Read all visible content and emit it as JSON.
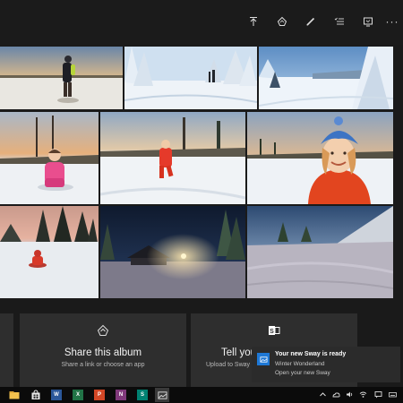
{
  "toolbar": {
    "buttons": [
      "share-upload",
      "enhance",
      "edit",
      "select",
      "present",
      "more"
    ],
    "more_label": "···"
  },
  "photos": [
    {
      "name": "photo-snow-child-standing",
      "scene": "snow field at dusk with child in black coat"
    },
    {
      "name": "photo-snowy-trees-people",
      "scene": "snowy forest with two people"
    },
    {
      "name": "photo-snow-covered-pines",
      "scene": "snow covered pines under blue sky"
    },
    {
      "name": "photo-girl-sitting-snow",
      "scene": "girl in pink jacket sitting in snow"
    },
    {
      "name": "photo-child-walking-snow",
      "scene": "child in red suit walking on snow"
    },
    {
      "name": "photo-girl-blue-hat",
      "scene": "smiling girl in blue hat and red coat"
    },
    {
      "name": "photo-child-sled-dusk",
      "scene": "child on sled at dusk"
    },
    {
      "name": "photo-cabin-night",
      "scene": "cabin at night with lamp"
    },
    {
      "name": "photo-snow-slope-twilight",
      "scene": "snowy slope at twilight"
    }
  ],
  "cards": {
    "share": {
      "title": "Share this album",
      "subtitle": "Share a link or choose an app"
    },
    "sway": {
      "title": "Tell your",
      "subtitle": "Upload to Sway"
    }
  },
  "toast": {
    "title": "Your new Sway is ready",
    "line1": "Winter Wonderland",
    "line2": "Open your new Sway"
  },
  "taskbar": {
    "apps": [
      {
        "name": "file-explorer-icon",
        "color": "#f2c14e",
        "letter": ""
      },
      {
        "name": "store-icon",
        "color": "#e8e8e8",
        "letter": ""
      },
      {
        "name": "word-icon",
        "color": "#2b579a",
        "letter": "W"
      },
      {
        "name": "excel-icon",
        "color": "#217346",
        "letter": "X"
      },
      {
        "name": "powerpoint-icon",
        "color": "#d24726",
        "letter": "P"
      },
      {
        "name": "onenote-icon",
        "color": "#80397b",
        "letter": "N"
      },
      {
        "name": "sway-icon",
        "color": "#008272",
        "letter": "S"
      },
      {
        "name": "photos-app-icon",
        "color": "#dddddd",
        "letter": ""
      }
    ]
  },
  "colors": {
    "background": "#1a1a1a",
    "card": "#2e2e2e",
    "toast": "#2b2b2b",
    "taskbar": "#0b0b0b",
    "accent": "#1e78d6"
  }
}
